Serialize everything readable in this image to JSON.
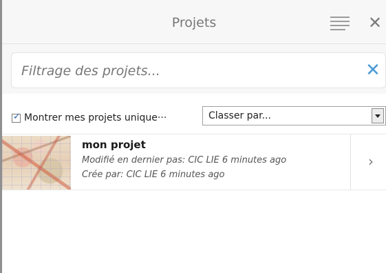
{
  "header": {
    "title": "Projets",
    "menu_icon": "hamburger-menu-icon",
    "close_label": "✕"
  },
  "filter": {
    "placeholder": "Filtrage des projets...",
    "value": "",
    "clear_label": "✕"
  },
  "options": {
    "only_mine_label": "Montrer mes projets unique···",
    "only_mine_checked": true,
    "sort_label": "Classer par..."
  },
  "projects": [
    {
      "name": "mon projet",
      "modified": "Modifié en dernier pas: CIC LIE 6 minutes ago",
      "created": "Crée par: CIC LIE 6 minutes ago",
      "chevron": "›"
    }
  ],
  "colors": {
    "accent": "#4a9bd6",
    "header_bg": "#f7f7f7",
    "text_muted": "#777777"
  }
}
